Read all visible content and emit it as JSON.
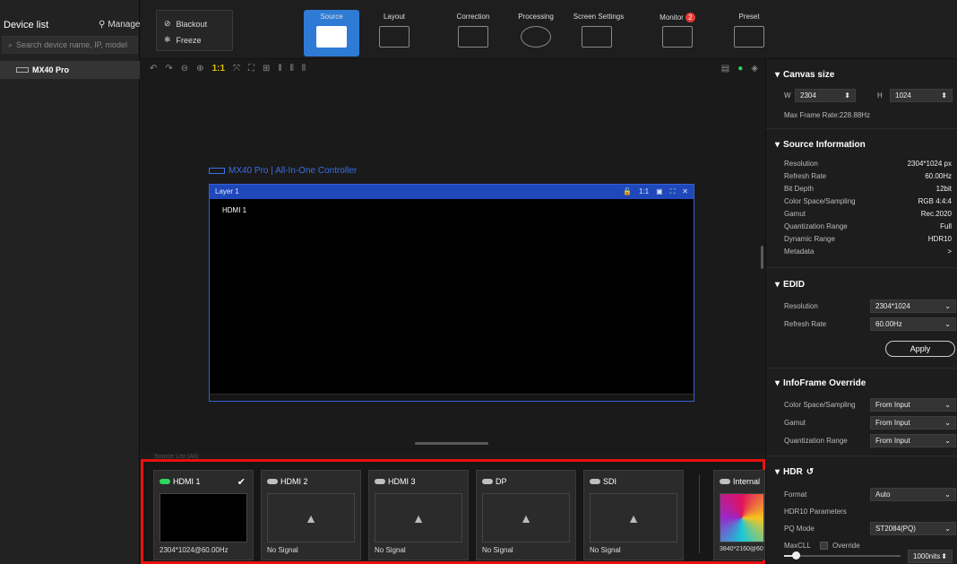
{
  "sidebar": {
    "title": "Device list",
    "manage_label": "Manage",
    "search_placeholder": "Search device name, IP, model",
    "device": "MX40 Pro"
  },
  "toolbar": {
    "blackout": "Blackout",
    "freeze": "Freeze",
    "tabs": [
      {
        "label": "Source",
        "active": true
      },
      {
        "label": "Layout"
      },
      {
        "label": "Correction"
      },
      {
        "label": "Processing"
      },
      {
        "label": "Screen Settings"
      },
      {
        "label": "Monitor",
        "badge": "2"
      },
      {
        "label": "Preset"
      }
    ],
    "scale_label": "1:1"
  },
  "canvas": {
    "controller_title": "MX40 Pro | All-In-One Controller",
    "layer_name": "Layer 1",
    "layer_source": "HDMI 1",
    "layer_scale": "1:1",
    "sources_label": "Source List (Ali)"
  },
  "canvas_size": {
    "title": "Canvas size",
    "w_label": "W",
    "w_value": "2304",
    "h_label": "H",
    "h_value": "1024",
    "max_frame_rate": "Max Frame Rate:228.88Hz"
  },
  "source_info": {
    "title": "Source Information",
    "rows": [
      {
        "k": "Resolution",
        "v": "2304*1024 px"
      },
      {
        "k": "Refresh Rate",
        "v": "60.00Hz"
      },
      {
        "k": "Bit Depth",
        "v": "12bit"
      },
      {
        "k": "Color Space/Sampling",
        "v": "RGB 4:4:4"
      },
      {
        "k": "Gamut",
        "v": "Rec.2020"
      },
      {
        "k": "Quantization Range",
        "v": "Full"
      },
      {
        "k": "Dynamic Range",
        "v": "HDR10"
      },
      {
        "k": "Metadata",
        "v": ">"
      }
    ]
  },
  "edid": {
    "title": "EDID",
    "resolution_label": "Resolution",
    "resolution_value": "2304*1024",
    "refresh_label": "Refresh Rate",
    "refresh_value": "60.00Hz",
    "apply": "Apply"
  },
  "infoframe": {
    "title": "InfoFrame Override",
    "rows": [
      {
        "k": "Color Space/Sampling",
        "v": "From Input"
      },
      {
        "k": "Gamut",
        "v": "From Input"
      },
      {
        "k": "Quantization Range",
        "v": "From Input"
      }
    ]
  },
  "hdr": {
    "title": "HDR",
    "format_label": "Format",
    "format_value": "Auto",
    "params_label": "HDR10 Parameters",
    "pq_label": "PQ Mode",
    "pq_value": "ST2084(PQ)",
    "maxcll_label": "MaxCLL",
    "override_label": "Override",
    "nits_value": "1000nits"
  },
  "sources": [
    {
      "name": "HDMI 1",
      "status": "2304*1024@60.00Hz",
      "active": true
    },
    {
      "name": "HDMI 2",
      "status": "No Signal"
    },
    {
      "name": "HDMI 3",
      "status": "No Signal"
    },
    {
      "name": "DP",
      "status": "No Signal"
    },
    {
      "name": "SDI",
      "status": "No Signal"
    },
    {
      "name": "Internal",
      "status": "3840*2160@60"
    }
  ]
}
